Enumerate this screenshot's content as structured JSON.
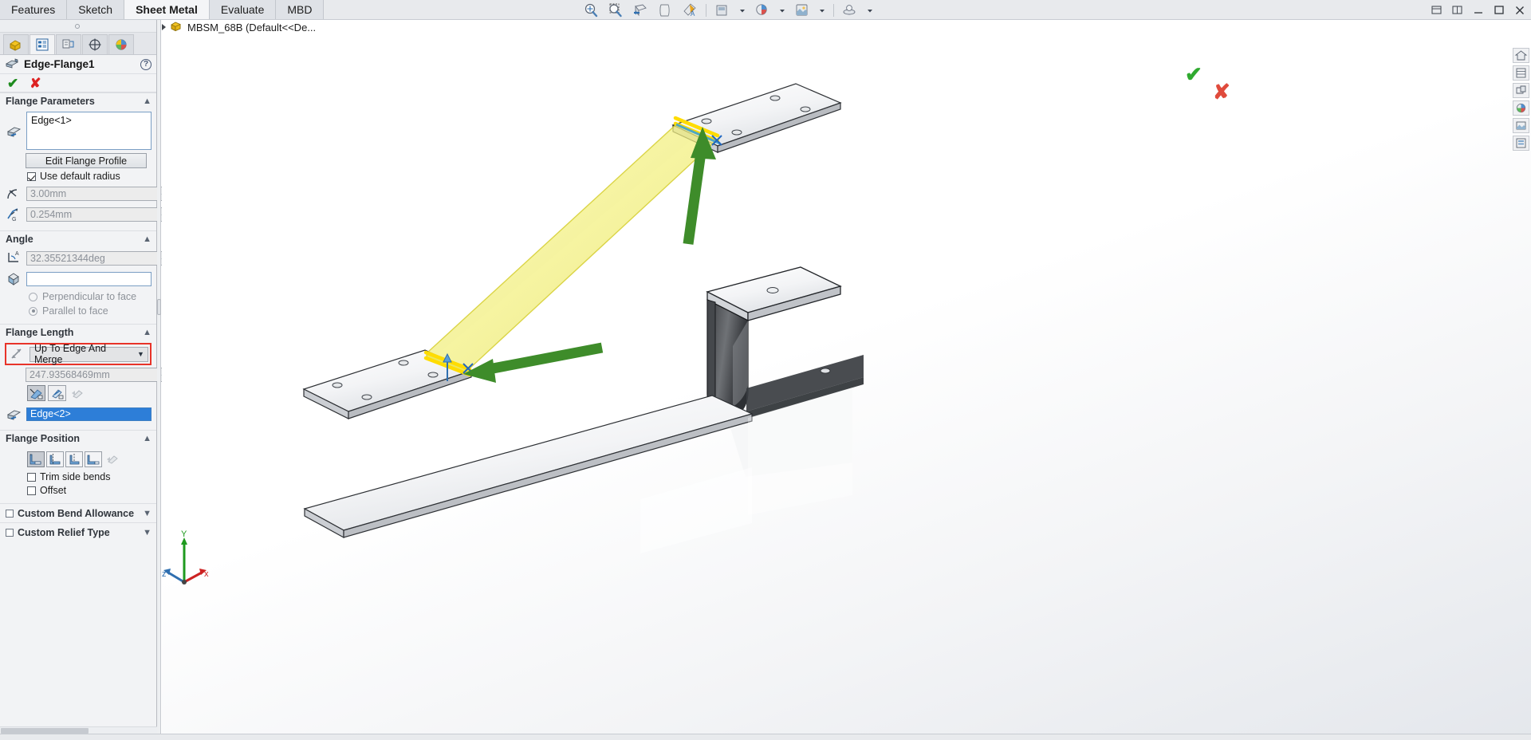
{
  "app": {
    "ribbon_tabs": [
      {
        "label": "Features",
        "active": false
      },
      {
        "label": "Sketch",
        "active": false
      },
      {
        "label": "Sheet Metal",
        "active": true
      },
      {
        "label": "Evaluate",
        "active": false
      },
      {
        "label": "MBD",
        "active": false
      }
    ],
    "top_toolbar_icons": [
      "zoom-to-fit-icon",
      "zoom-to-area-icon",
      "section-view-icon",
      "view-orientation-icon",
      "display-style-icon",
      "hide-show-items-icon",
      "edit-appearance-icon",
      "apply-scene-icon",
      "view-settings-icon"
    ],
    "window_buttons": [
      "restore-window-icon",
      "split-window-icon",
      "minimize-icon",
      "maximize-icon",
      "close-icon"
    ]
  },
  "feature_tree": {
    "root_label": "MBSM_68B  (Default<<De...",
    "expander": "collapsed-triangle-icon",
    "part_icon": "part-document-icon"
  },
  "property_manager": {
    "tabs": [
      {
        "name": "feature-manager-tab",
        "icon": "part-tree-icon",
        "active": false
      },
      {
        "name": "property-manager-tab",
        "icon": "property-list-icon",
        "active": true
      },
      {
        "name": "configuration-manager-tab",
        "icon": "configurations-icon",
        "active": false
      },
      {
        "name": "dimxpert-manager-tab",
        "icon": "dimxpert-icon",
        "active": false
      },
      {
        "name": "display-manager-tab",
        "icon": "appearances-icon",
        "active": false
      }
    ],
    "title": "Edge-Flange1",
    "title_icon": "edge-flange-icon",
    "help_label": "?",
    "ok_glyph": "✔",
    "cancel_glyph": "✘",
    "sections": {
      "flange_parameters": {
        "header": "Flange Parameters",
        "edge_selection_value": "Edge<1>",
        "edge_selection_icon": "edge-select-icon",
        "edit_profile_button": "Edit Flange Profile",
        "use_default_radius_label": "Use default radius",
        "use_default_radius_checked": true,
        "radius_value": "3.00mm",
        "radius_icon": "bend-radius-icon",
        "gap_value": "0.254mm",
        "gap_icon": "gap-distance-icon"
      },
      "angle": {
        "header": "Angle",
        "angle_value": "32.35521344deg",
        "angle_icon": "flange-angle-icon",
        "lock_icon": "reverse-direction-icon",
        "face_ref_value": "",
        "face_ref_icon": "face-reference-icon",
        "perpendicular_label": "Perpendicular to face",
        "perpendicular_selected": false,
        "parallel_label": "Parallel to face",
        "parallel_selected": true
      },
      "flange_length": {
        "header": "Flange Length",
        "end_condition": "Up To Edge And Merge",
        "end_condition_icon": "length-end-condition-icon",
        "dropdown_arrow": "chevron-down-icon",
        "highlighted": true,
        "highlight_color": "#e83329",
        "length_value": "247.93568469mm",
        "measure_buttons": [
          {
            "name": "outer-virtual-sharp-button",
            "selected": true
          },
          {
            "name": "inner-virtual-sharp-button",
            "selected": false
          },
          {
            "name": "tangent-bend-button",
            "selected": false,
            "disabled": true
          }
        ],
        "edge_selection_value": "Edge<2>",
        "edge_selection_icon": "edge-select-icon",
        "edge_selection_active": true
      },
      "flange_position": {
        "header": "Flange Position",
        "position_buttons": [
          {
            "name": "material-inside-button",
            "selected": true
          },
          {
            "name": "material-outside-button",
            "selected": false
          },
          {
            "name": "bend-outside-button",
            "selected": false
          },
          {
            "name": "bend-from-virtual-sharp-button",
            "selected": false
          },
          {
            "name": "tangent-to-bend-button",
            "selected": false,
            "disabled": true
          }
        ],
        "trim_side_bends_label": "Trim side bends",
        "trim_side_bends_checked": false,
        "offset_label": "Offset",
        "offset_checked": false
      },
      "custom_bend_allowance": {
        "header": "Custom Bend Allowance",
        "checked": false,
        "chevron": "chevron-down-icon"
      },
      "custom_relief_type": {
        "header": "Custom Relief Type",
        "checked": false,
        "chevron": "chevron-down-icon"
      }
    }
  },
  "graphics": {
    "confirm_corner": {
      "ok_glyph": "✔",
      "cancel_glyph": "✘"
    },
    "triad": {
      "x_label": "x",
      "y_label": "Y",
      "z_label": "z"
    },
    "annotations": {
      "arrow_color": "#3e8c2a",
      "preview_fill": "#f2f07a",
      "preview_edge": "#e6c423",
      "selected_edge_color": "#ffd400"
    },
    "right_toolbar_icons": [
      "view-orientation-home-icon",
      "display-pane-icon",
      "hide-show-icon",
      "appearances-icon",
      "scene-icon",
      "display-states-icon"
    ]
  }
}
